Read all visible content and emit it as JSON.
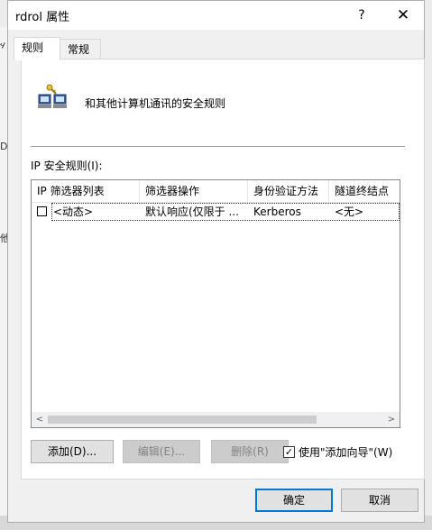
{
  "background": {
    "left_fragments": [
      "ሃ",
      "D",
      "他"
    ]
  },
  "dialog": {
    "title": "rdrol 属性",
    "help_glyph": "?",
    "close_glyph": "✕",
    "tabs": [
      {
        "label": "规则",
        "active": true
      },
      {
        "label": "常规",
        "active": false
      }
    ],
    "description": "和其他计算机通讯的安全规则",
    "rules_label": "IP 安全规则(I):",
    "list": {
      "columns": [
        "IP 筛选器列表",
        "筛选器操作",
        "身份验证方法",
        "隧道终结点"
      ],
      "rows": [
        {
          "checked": false,
          "cells": [
            "<动态>",
            "默认响应(仅限于 ...",
            "Kerberos",
            "<无>"
          ]
        }
      ],
      "scroll_left": "<",
      "scroll_right": ">"
    },
    "buttons": {
      "add": "添加(D)...",
      "edit": "编辑(E)...",
      "remove": "删除(R)",
      "ok": "确定",
      "cancel": "取消"
    },
    "wizard_checkbox": {
      "checked": true,
      "label": "使用\"添加向导\"(W)",
      "mark": "✓"
    }
  }
}
